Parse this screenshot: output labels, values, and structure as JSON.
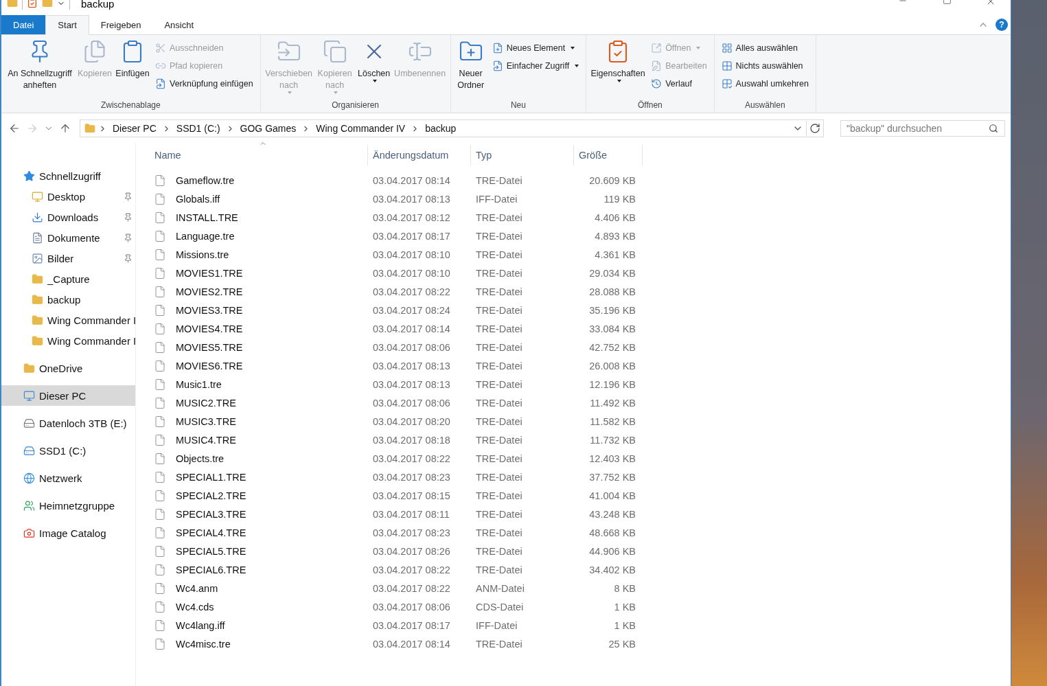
{
  "window": {
    "title": "backup",
    "help": "?"
  },
  "ribbon_tabs": [
    {
      "label": "Datei",
      "kind": "file",
      "selected": false
    },
    {
      "label": "Start",
      "kind": "tab",
      "selected": true
    },
    {
      "label": "Freigeben",
      "kind": "tab",
      "selected": false
    },
    {
      "label": "Ansicht",
      "kind": "tab",
      "selected": false
    }
  ],
  "ribbon_groups": [
    {
      "label": "Zwischenablage",
      "items": [
        {
          "label": "An Schnellzugriff anheften",
          "kind": "large",
          "disabled": false,
          "dropdown": false
        },
        {
          "label": "Kopieren",
          "kind": "large",
          "disabled": true,
          "dropdown": false
        },
        {
          "label": "Einfügen",
          "kind": "large",
          "disabled": false,
          "dropdown": false
        },
        {
          "label": "Ausschneiden",
          "kind": "small",
          "disabled": true,
          "dropdown": false
        },
        {
          "label": "Pfad kopieren",
          "kind": "small",
          "disabled": true,
          "dropdown": false
        },
        {
          "label": "Verknüpfung einfügen",
          "kind": "small",
          "disabled": false,
          "dropdown": false
        }
      ]
    },
    {
      "label": "Organisieren",
      "items": [
        {
          "label": "Verschieben nach",
          "kind": "large",
          "disabled": true,
          "dropdown": true
        },
        {
          "label": "Kopieren nach",
          "kind": "large",
          "disabled": true,
          "dropdown": true
        },
        {
          "label": "Löschen",
          "kind": "large",
          "disabled": false,
          "dropdown": true
        },
        {
          "label": "Umbenennen",
          "kind": "large",
          "disabled": true,
          "dropdown": false
        }
      ]
    },
    {
      "label": "Neu",
      "items": [
        {
          "label": "Neuer Ordner",
          "kind": "large",
          "disabled": false,
          "dropdown": false
        },
        {
          "label": "Neues Element",
          "kind": "small",
          "disabled": false,
          "dropdown": true
        },
        {
          "label": "Einfacher Zugriff",
          "kind": "small",
          "disabled": false,
          "dropdown": true
        }
      ]
    },
    {
      "label": "Öffnen",
      "items": [
        {
          "label": "Eigenschaften",
          "kind": "large",
          "disabled": false,
          "dropdown": true
        },
        {
          "label": "Öffnen",
          "kind": "small",
          "disabled": true,
          "dropdown": true
        },
        {
          "label": "Bearbeiten",
          "kind": "small",
          "disabled": true,
          "dropdown": false
        },
        {
          "label": "Verlauf",
          "kind": "small",
          "disabled": false,
          "dropdown": false
        }
      ]
    },
    {
      "label": "Auswählen",
      "items": [
        {
          "label": "Alles auswählen",
          "kind": "small",
          "disabled": false,
          "dropdown": false
        },
        {
          "label": "Nichts auswählen",
          "kind": "small",
          "disabled": false,
          "dropdown": false
        },
        {
          "label": "Auswahl umkehren",
          "kind": "small",
          "disabled": false,
          "dropdown": false
        }
      ]
    }
  ],
  "nav_buttons": [
    {
      "kind": "back",
      "disabled": false
    },
    {
      "kind": "forward",
      "disabled": true
    },
    {
      "kind": "recent",
      "disabled": false
    },
    {
      "kind": "up",
      "disabled": false
    }
  ],
  "breadcrumb": [
    "Dieser PC",
    "SSD1 (C:)",
    "GOG Games",
    "Wing Commander IV",
    "backup"
  ],
  "search": {
    "placeholder": "\"backup\" durchsuchen"
  },
  "sidebar": [
    {
      "label": "Schnellzugriff",
      "kind": "quick",
      "selected": false,
      "children": [
        {
          "label": "Desktop",
          "kind": "desktop",
          "pinned": true,
          "selected": false
        },
        {
          "label": "Downloads",
          "kind": "downloads",
          "pinned": true,
          "selected": false
        },
        {
          "label": "Dokumente",
          "kind": "documents",
          "pinned": true,
          "selected": false
        },
        {
          "label": "Bilder",
          "kind": "pictures",
          "pinned": true,
          "selected": false
        },
        {
          "label": "_Capture",
          "kind": "folder",
          "pinned": false,
          "selected": false
        },
        {
          "label": "backup",
          "kind": "folder",
          "pinned": false,
          "selected": false
        },
        {
          "label": "Wing Commander I",
          "kind": "folder",
          "pinned": false,
          "selected": false
        },
        {
          "label": "Wing Commander I",
          "kind": "folder",
          "pinned": false,
          "selected": false
        }
      ]
    },
    {
      "label": "OneDrive",
      "kind": "folder",
      "selected": false
    },
    {
      "label": "Dieser PC",
      "kind": "pc",
      "selected": true
    },
    {
      "label": "Datenloch 3TB (E:)",
      "kind": "drive",
      "selected": false
    },
    {
      "label": "SSD1 (C:)",
      "kind": "system-drive",
      "selected": false
    },
    {
      "label": "Netzwerk",
      "kind": "network",
      "selected": false
    },
    {
      "label": "Heimnetzgruppe",
      "kind": "homegroup",
      "selected": false
    },
    {
      "label": "Image Catalog",
      "kind": "app",
      "selected": false
    }
  ],
  "columns": [
    {
      "label": "Name",
      "sorted": true
    },
    {
      "label": "Änderungsdatum",
      "sorted": false
    },
    {
      "label": "Typ",
      "sorted": false
    },
    {
      "label": "Größe",
      "sorted": false
    }
  ],
  "files": [
    [
      "Gameflow.tre",
      "03.04.2017 08:14",
      "TRE-Datei",
      "20.609 KB"
    ],
    [
      "Globals.iff",
      "03.04.2017 08:13",
      "IFF-Datei",
      "119 KB"
    ],
    [
      "INSTALL.TRE",
      "03.04.2017 08:12",
      "TRE-Datei",
      "4.406 KB"
    ],
    [
      "Language.tre",
      "03.04.2017 08:17",
      "TRE-Datei",
      "4.893 KB"
    ],
    [
      "Missions.tre",
      "03.04.2017 08:10",
      "TRE-Datei",
      "4.361 KB"
    ],
    [
      "MOVIES1.TRE",
      "03.04.2017 08:10",
      "TRE-Datei",
      "29.034 KB"
    ],
    [
      "MOVIES2.TRE",
      "03.04.2017 08:22",
      "TRE-Datei",
      "28.088 KB"
    ],
    [
      "MOVIES3.TRE",
      "03.04.2017 08:24",
      "TRE-Datei",
      "35.196 KB"
    ],
    [
      "MOVIES4.TRE",
      "03.04.2017 08:14",
      "TRE-Datei",
      "33.084 KB"
    ],
    [
      "MOVIES5.TRE",
      "03.04.2017 08:06",
      "TRE-Datei",
      "42.752 KB"
    ],
    [
      "MOVIES6.TRE",
      "03.04.2017 08:13",
      "TRE-Datei",
      "26.008 KB"
    ],
    [
      "Music1.tre",
      "03.04.2017 08:13",
      "TRE-Datei",
      "12.196 KB"
    ],
    [
      "MUSIC2.TRE",
      "03.04.2017 08:06",
      "TRE-Datei",
      "11.492 KB"
    ],
    [
      "MUSIC3.TRE",
      "03.04.2017 08:20",
      "TRE-Datei",
      "11.582 KB"
    ],
    [
      "MUSIC4.TRE",
      "03.04.2017 08:18",
      "TRE-Datei",
      "11.732 KB"
    ],
    [
      "Objects.tre",
      "03.04.2017 08:22",
      "TRE-Datei",
      "12.403 KB"
    ],
    [
      "SPECIAL1.TRE",
      "03.04.2017 08:23",
      "TRE-Datei",
      "37.752 KB"
    ],
    [
      "SPECIAL2.TRE",
      "03.04.2017 08:15",
      "TRE-Datei",
      "41.004 KB"
    ],
    [
      "SPECIAL3.TRE",
      "03.04.2017 08:11",
      "TRE-Datei",
      "43.248 KB"
    ],
    [
      "SPECIAL4.TRE",
      "03.04.2017 08:23",
      "TRE-Datei",
      "48.668 KB"
    ],
    [
      "SPECIAL5.TRE",
      "03.04.2017 08:26",
      "TRE-Datei",
      "44.906 KB"
    ],
    [
      "SPECIAL6.TRE",
      "03.04.2017 08:22",
      "TRE-Datei",
      "34.402 KB"
    ],
    [
      "Wc4.anm",
      "03.04.2017 08:22",
      "ANM-Datei",
      "8 KB"
    ],
    [
      "Wc4.cds",
      "03.04.2017 08:06",
      "CDS-Datei",
      "1 KB"
    ],
    [
      "Wc4lang.iff",
      "03.04.2017 08:17",
      "IFF-Datei",
      "1 KB"
    ],
    [
      "Wc4misc.tre",
      "03.04.2017 08:14",
      "TRE-Datei",
      "25 KB"
    ]
  ]
}
